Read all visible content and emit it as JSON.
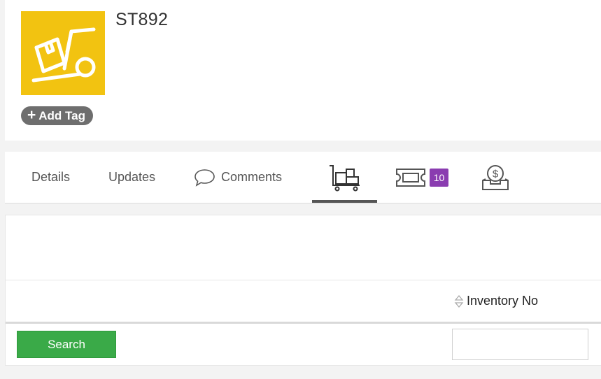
{
  "header": {
    "title": "ST892",
    "logo_icon": "hand-truck-icon",
    "logo_bg": "#f2c311",
    "add_tag_label": "Add Tag"
  },
  "tabs": [
    {
      "label": "Details",
      "active": false
    },
    {
      "label": "Updates",
      "active": false
    },
    {
      "label": "Comments",
      "icon": "comment-bubble-icon",
      "active": false
    },
    {
      "label": "",
      "icon": "cart-icon",
      "active": true
    },
    {
      "label": "",
      "icon": "ticket-icon",
      "badge": "10",
      "active": false
    },
    {
      "label": "",
      "icon": "money-tray-icon",
      "active": false
    }
  ],
  "table": {
    "column_header": "Inventory No",
    "sort_icon": "sort-icon"
  },
  "actions": {
    "search_label": "Search",
    "filter_value": ""
  },
  "colors": {
    "accent_green": "#3aaa48",
    "badge_purple": "#8a3cb0",
    "tag_grey": "#6e6e6e"
  }
}
